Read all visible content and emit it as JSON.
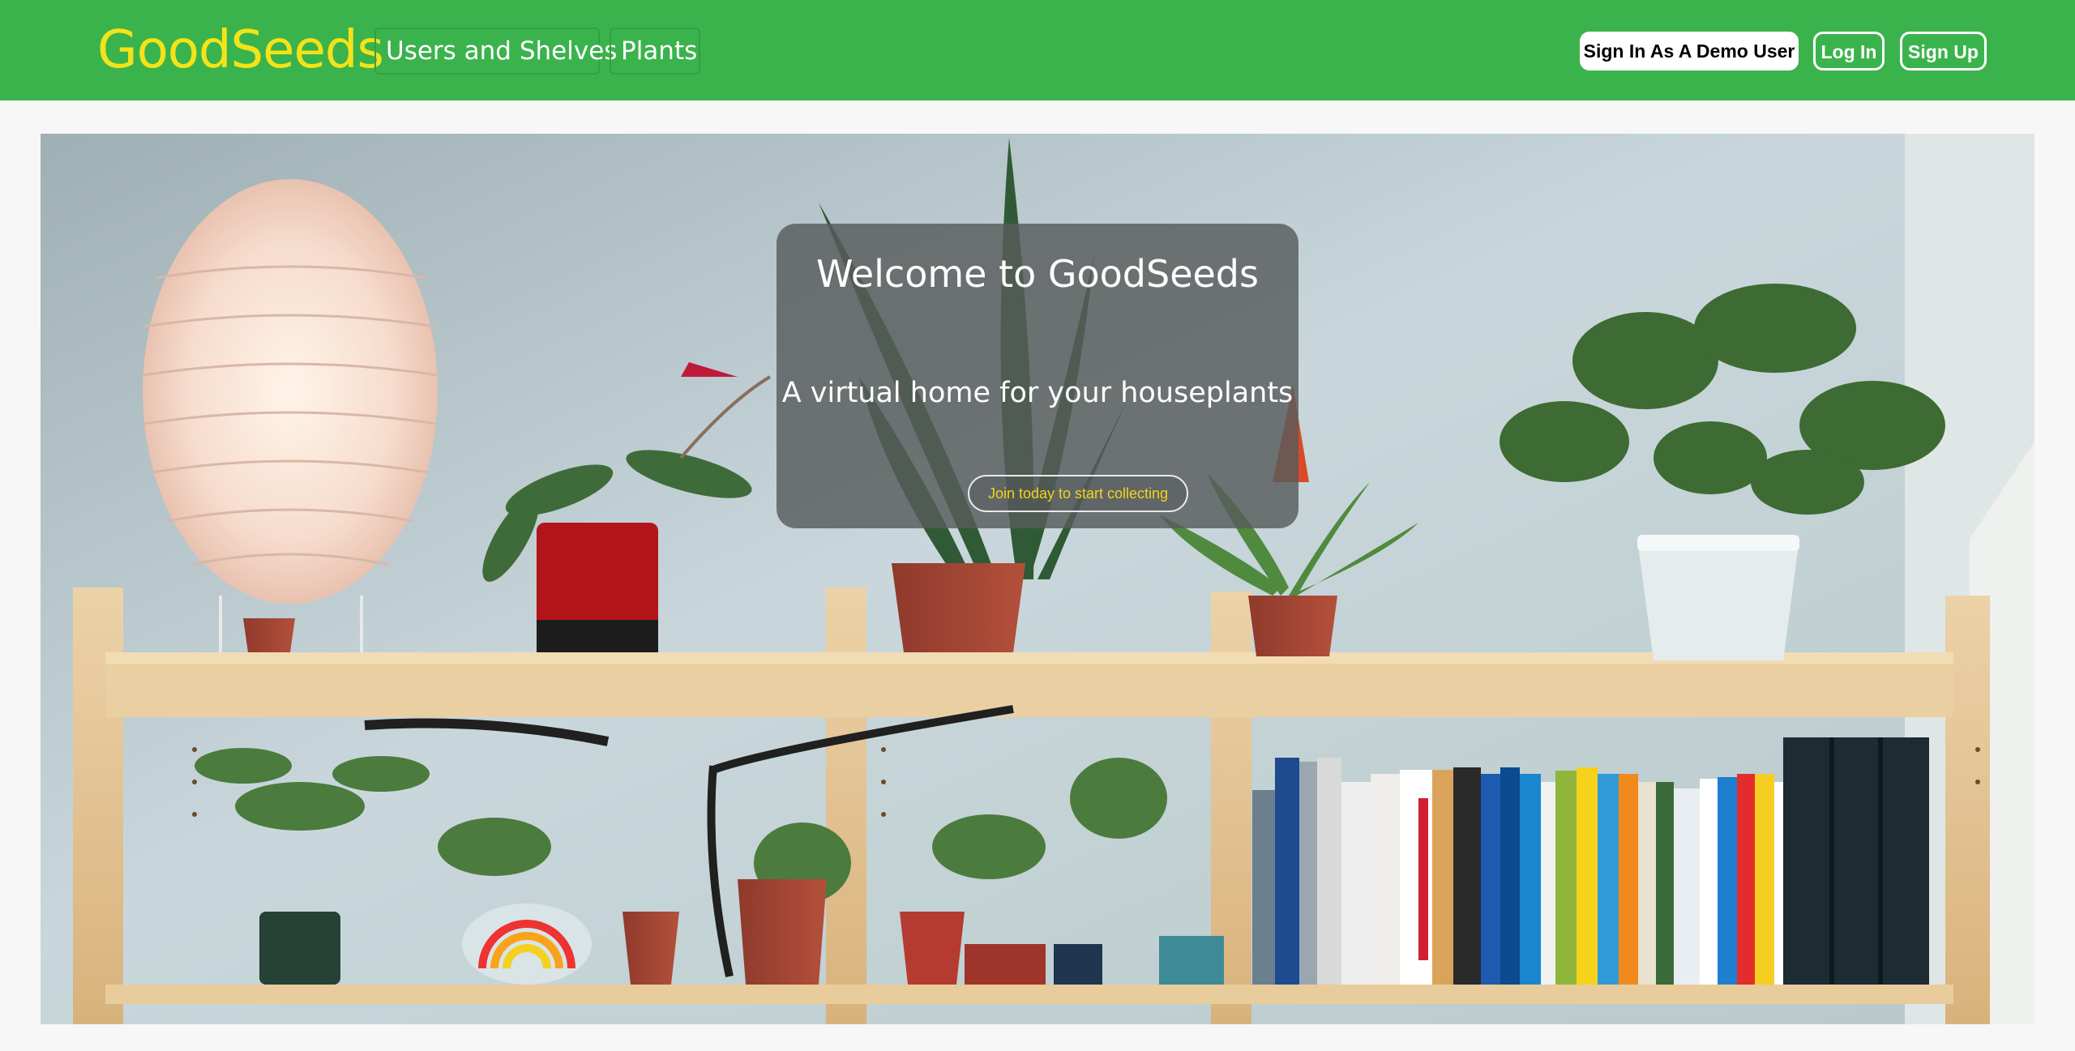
{
  "navbar": {
    "brand": "GoodSeeds",
    "links": {
      "users_shelves": "Users and Shelves",
      "plants": "Plants"
    },
    "buttons": {
      "demo": "Sign In As A Demo User",
      "login": "Log In",
      "signup": "Sign Up"
    }
  },
  "hero": {
    "title": "Welcome to GoodSeeds",
    "subtitle": "A virtual home for your houseplants",
    "cta": "Join today to start collecting"
  },
  "colors": {
    "navbar_bg": "#3bb34d",
    "brand": "#f4e318",
    "cta_text": "#f4d31b",
    "page_bg": "#f7f7f7"
  }
}
